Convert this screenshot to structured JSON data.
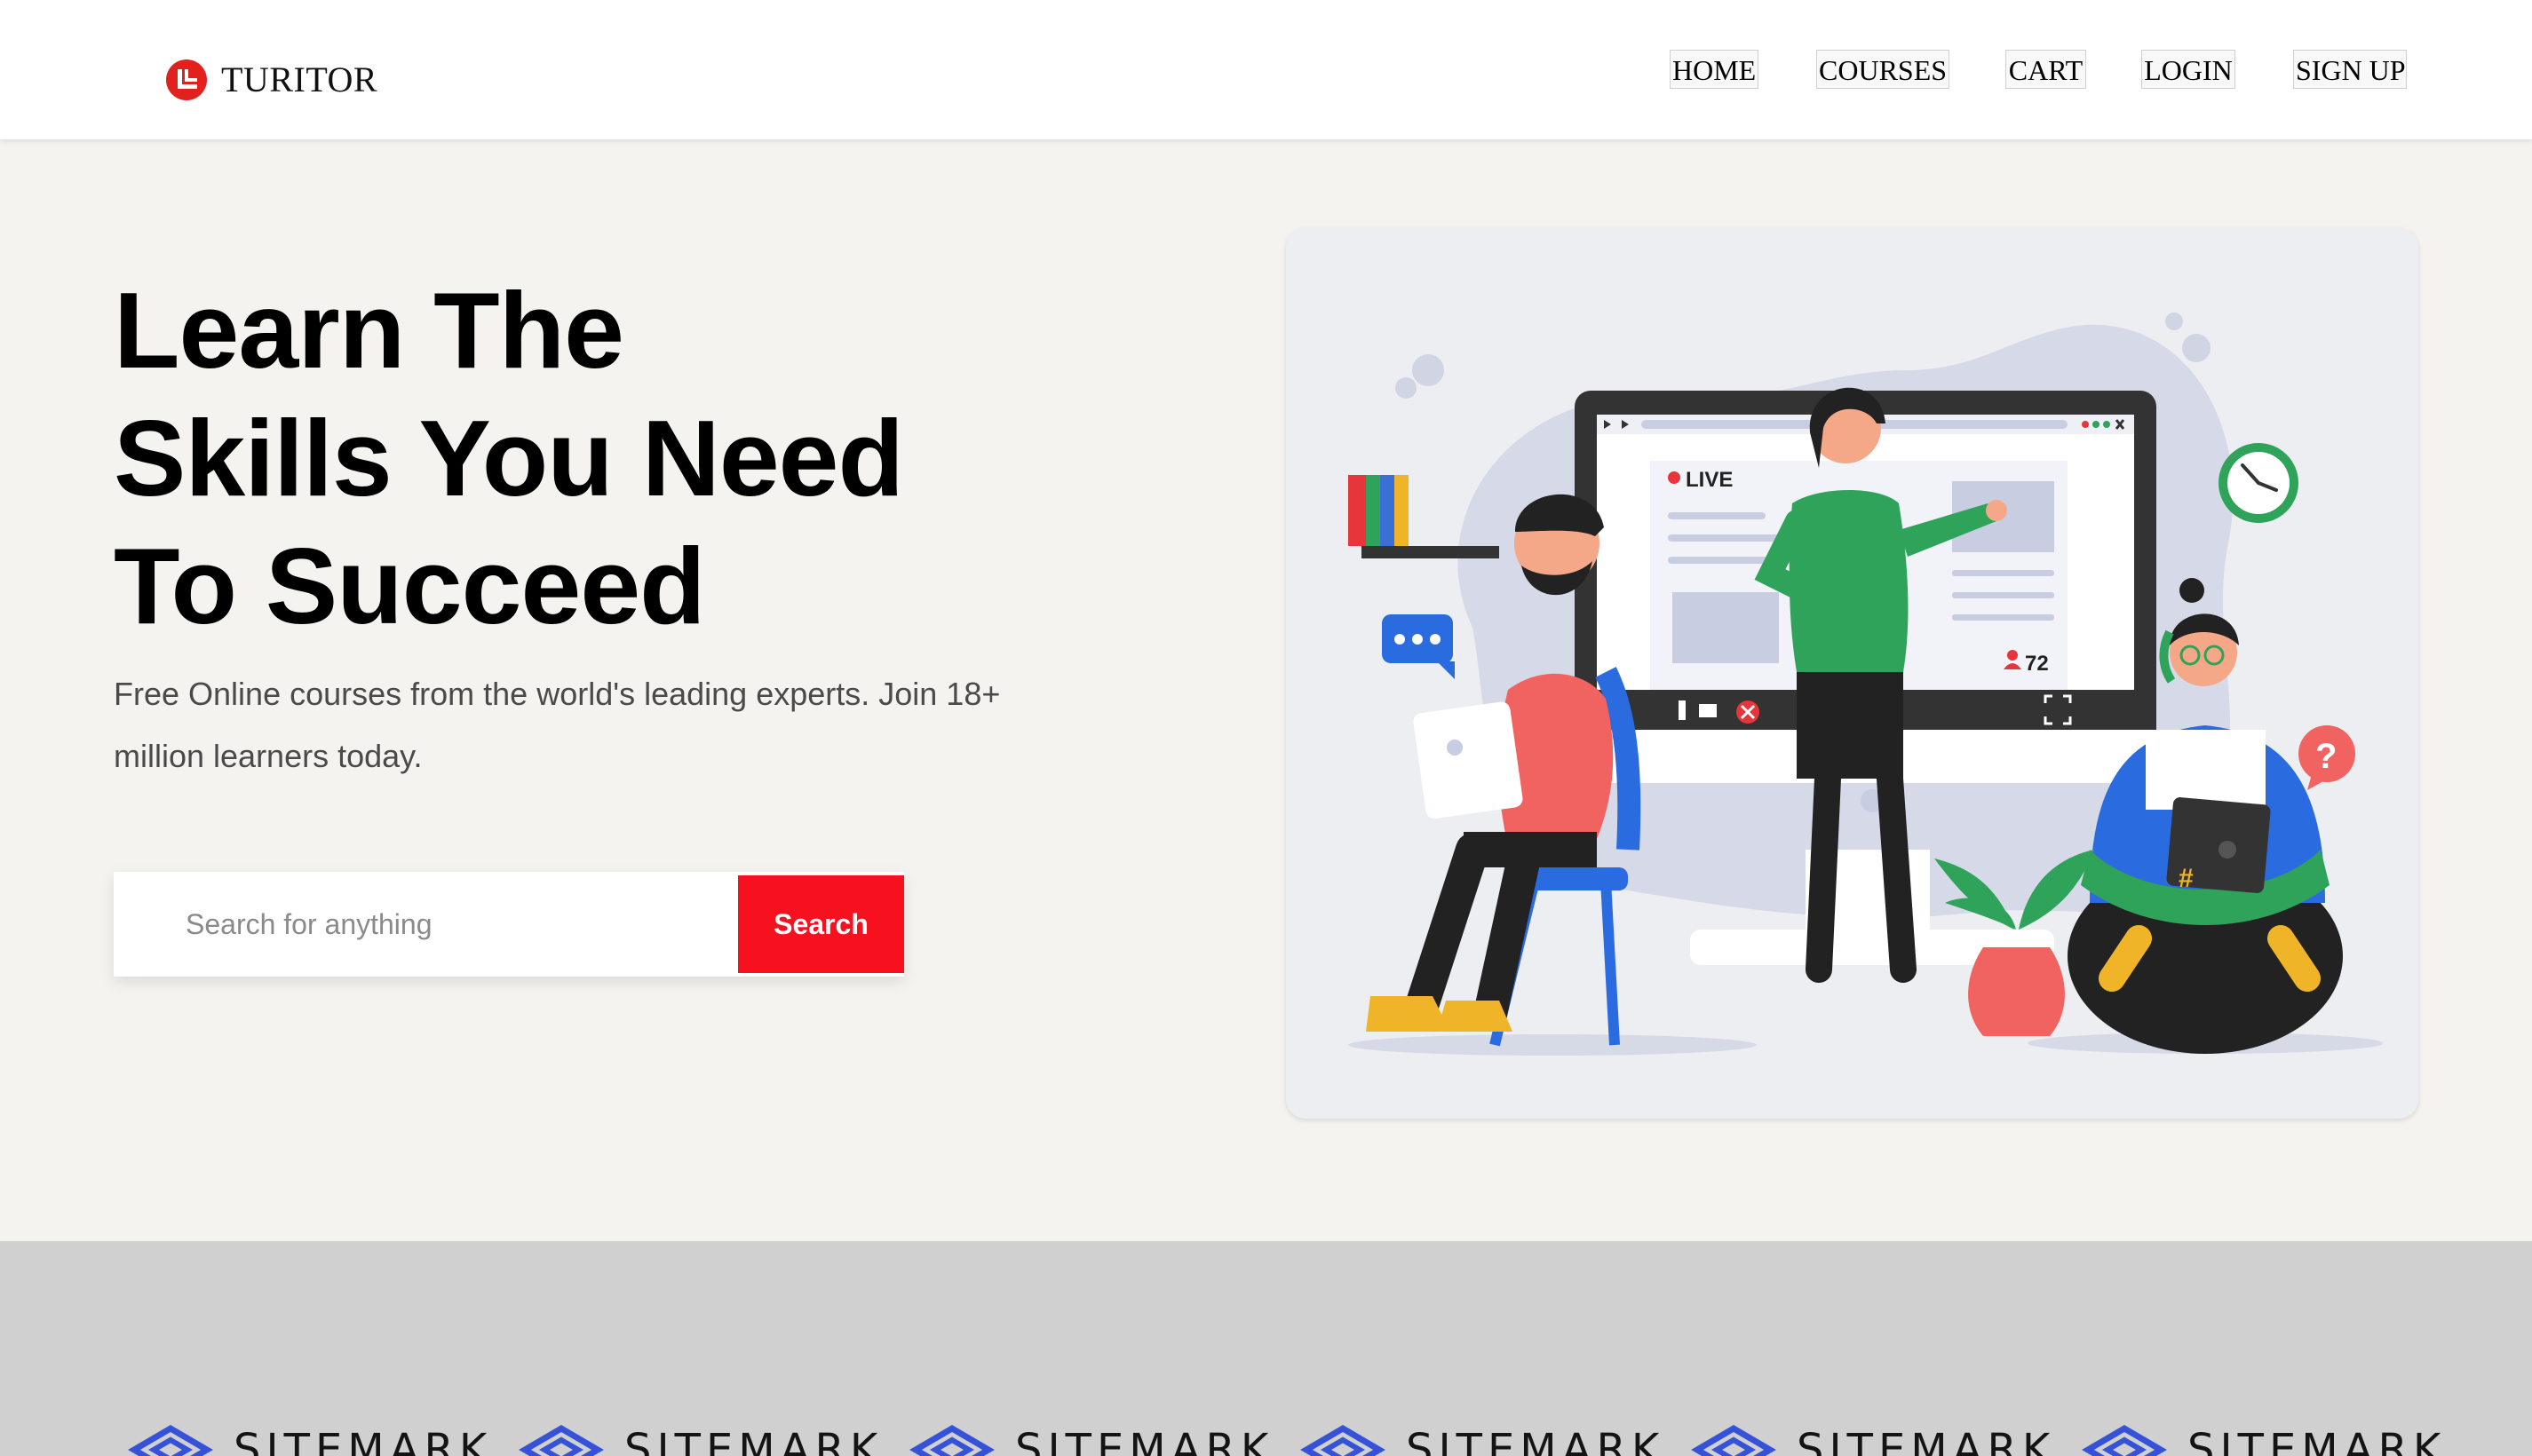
{
  "brand": {
    "name": "TURITOR",
    "logo_icon": "turitor-logo-icon",
    "accent_color": "#e0211d"
  },
  "nav": {
    "items": [
      {
        "label": "HOME"
      },
      {
        "label": "COURSES"
      },
      {
        "label": "CART"
      },
      {
        "label": "LOGIN"
      },
      {
        "label": "SIGN UP"
      }
    ]
  },
  "hero": {
    "title_lines": [
      "Learn The",
      "Skills You Need",
      "To Succeed"
    ],
    "subtitle": "Free Online courses from the world's leading experts. Join 18+ million learners today.",
    "search": {
      "placeholder": "Search for anything",
      "button_label": "Search",
      "button_color": "#f7101d"
    }
  },
  "illustration": {
    "live_badge": "LIVE",
    "viewer_count": "72",
    "help_symbol": "?",
    "hashtag": "#"
  },
  "partners": {
    "items": [
      {
        "name": "SITEMARK",
        "icon": "sitemark-logo-icon"
      },
      {
        "name": "SITEMARK",
        "icon": "sitemark-logo-icon"
      },
      {
        "name": "SITEMARK",
        "icon": "sitemark-logo-icon"
      },
      {
        "name": "SITEMARK",
        "icon": "sitemark-logo-icon"
      },
      {
        "name": "SITEMARK",
        "icon": "sitemark-logo-icon"
      },
      {
        "name": "SITEMARK",
        "icon": "sitemark-logo-icon"
      }
    ]
  }
}
